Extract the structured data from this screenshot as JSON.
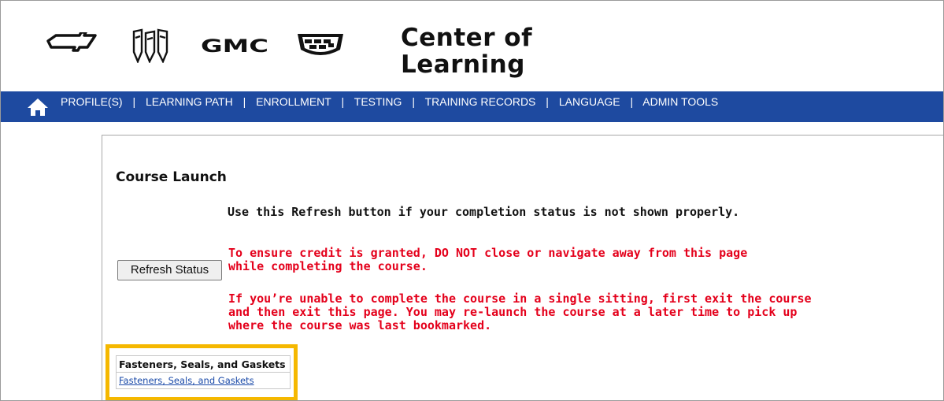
{
  "header": {
    "brand_logos": [
      "chevrolet-logo",
      "buick-logo",
      "gmc-logo",
      "cadillac-logo"
    ],
    "gmc_text": "GMC",
    "title_line1": "Center of",
    "title_line2": "Learning"
  },
  "nav": {
    "home_icon": "home-icon",
    "items": [
      {
        "label": "PROFILE(S)"
      },
      {
        "label": "LEARNING PATH"
      },
      {
        "label": "ENROLLMENT"
      },
      {
        "label": "TESTING"
      },
      {
        "label": "TRAINING RECORDS"
      },
      {
        "label": "LANGUAGE"
      },
      {
        "label": "ADMIN TOOLS"
      }
    ],
    "separator": "|"
  },
  "main": {
    "heading": "Course Launch",
    "refresh_hint": "Use this Refresh button if your completion status is not shown properly.",
    "refresh_button_label": "Refresh Status",
    "warning_credit": [
      "To ensure credit is granted, DO NOT close or navigate away from this page",
      "while completing the course."
    ],
    "warning_exit": [
      "If you’re unable to complete the course in a single sitting, first exit the course",
      "and then exit this page. You may re-launch the course at a later time to pick up",
      "where the course was last bookmarked."
    ],
    "course_table": {
      "header": "Fasteners, Seals, and Gaskets",
      "link": "Fasteners, Seals, and Gaskets"
    }
  },
  "colors": {
    "nav_background": "#1e4aa0",
    "warning_text": "#e4001b",
    "highlight_border": "#f5b800",
    "link": "#1a4aa8"
  }
}
